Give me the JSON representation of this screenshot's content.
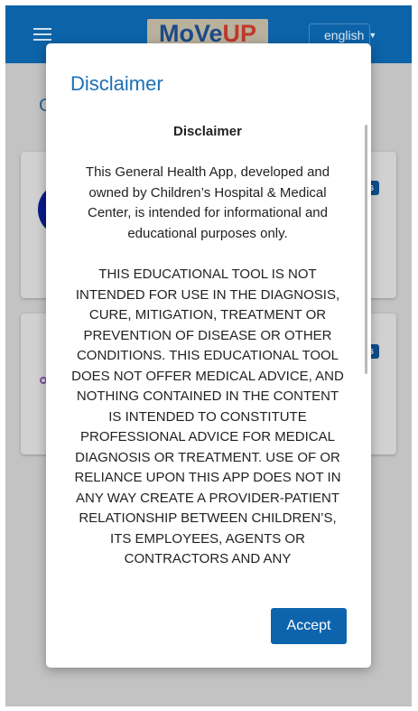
{
  "topbar": {
    "menu_icon": "hamburger-menu-icon",
    "logo_text": "MoVeUP",
    "logo_prefix": "MoVe",
    "logo_suffix": "UP",
    "language": "english",
    "language_caret_icon": "caret-down-icon",
    "background_color": "#0d63a8"
  },
  "background": {
    "title_partial": "G",
    "card1_badge": "s",
    "card2_badge": "s"
  },
  "modal": {
    "title": "Disclaimer",
    "content_heading": "Disclaimer",
    "paragraphs": [
      "This General Health App, developed and owned by Children’s Hospital & Medical Center, is intended for informational and educational purposes only.",
      "THIS EDUCATIONAL TOOL IS NOT INTENDED FOR USE IN THE DIAGNOSIS, CURE, MITIGATION, TREATMENT OR PREVENTION OF DISEASE OR OTHER CONDITIONS. THIS EDUCATIONAL TOOL DOES NOT OFFER MEDICAL ADVICE, AND NOTHING CONTAINED IN THE CONTENT IS INTENDED TO CONSTITUTE PROFESSIONAL ADVICE FOR MEDICAL DIAGNOSIS OR TREATMENT. USE OF OR RELIANCE UPON THIS APP DOES NOT IN ANY WAY CREATE A PROVIDER-PATIENT RELATIONSHIP BETWEEN CHILDREN’S, ITS EMPLOYEES, AGENTS OR CONTRACTORS AND ANY"
    ],
    "accept_label": "Accept",
    "accent_color": "#1c6fb7",
    "button_color": "#0e64ac"
  }
}
